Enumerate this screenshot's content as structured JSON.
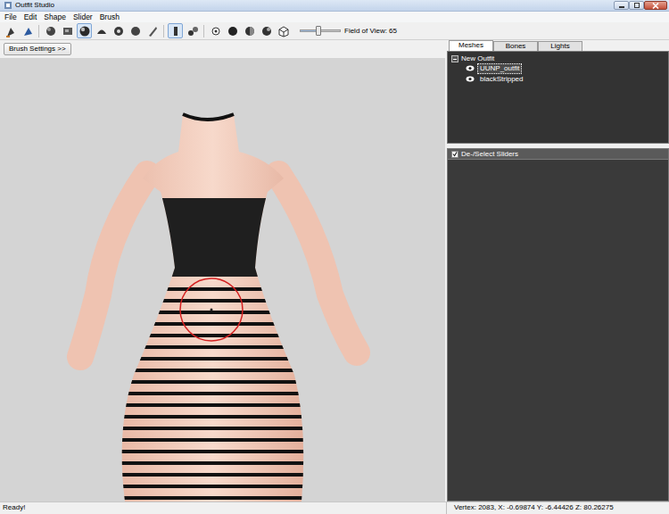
{
  "window": {
    "title": "Outfit Studio"
  },
  "menu": [
    "File",
    "Edit",
    "Shape",
    "Slider",
    "Brush"
  ],
  "toolbar": {
    "tools": [
      {
        "selected": false
      },
      {
        "selected": false
      },
      {
        "selected": false
      },
      {
        "selected": false
      },
      {
        "selected": true
      },
      {
        "selected": false
      },
      {
        "selected": false
      },
      {
        "selected": false
      },
      {
        "selected": false
      },
      {
        "selected": true
      },
      {
        "selected": false
      },
      {
        "selected": false
      },
      {
        "selected": false
      },
      {
        "selected": false
      },
      {
        "selected": false
      },
      {
        "selected": false
      }
    ],
    "fov": {
      "label": "Field of View: 65",
      "level": 0.45
    }
  },
  "brush_settings": "Brush Settings >>",
  "tabs": [
    {
      "label": "Meshes",
      "selected": true
    },
    {
      "label": "Bones",
      "selected": false
    },
    {
      "label": "Lights",
      "selected": false
    }
  ],
  "tree": {
    "root": {
      "label": "New Outfit",
      "expanded": true,
      "children": [
        {
          "label": "UUNP_outfit",
          "selected": true,
          "visible": true
        },
        {
          "label": "blackStripped",
          "selected": false,
          "visible": true
        }
      ]
    }
  },
  "sliders": {
    "label": "De-/Select Sliders",
    "checked": true
  },
  "status_bar": {
    "left": "Ready!",
    "right": "Vertex: 2083, X: -0.69874 Y: -6.44426 Z: 80.26275"
  }
}
